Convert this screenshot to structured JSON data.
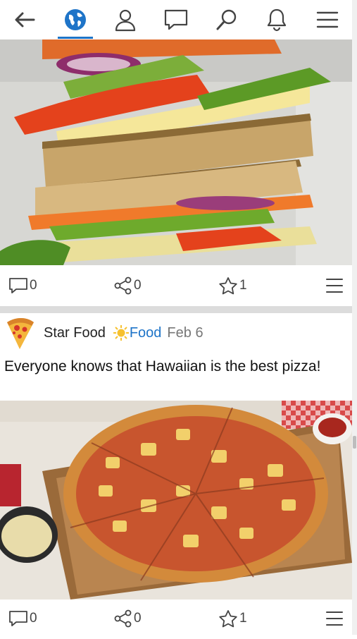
{
  "nav": {
    "items": [
      {
        "icon": "back-arrow-icon"
      },
      {
        "icon": "globe-icon",
        "active": true
      },
      {
        "icon": "profile-icon"
      },
      {
        "icon": "chat-icon"
      },
      {
        "icon": "search-icon"
      },
      {
        "icon": "bell-icon"
      },
      {
        "icon": "menu-icon"
      }
    ],
    "accent": "#1e74c8"
  },
  "posts": [
    {
      "image": "sandwich-photo",
      "actions": {
        "comments": "0",
        "shares": "0",
        "favorites": "1"
      }
    },
    {
      "avatar": "pizza-slice-icon",
      "author": "Star Food",
      "category": "Food",
      "category_icon": "sun-icon",
      "date": "Feb 6",
      "text": "Everyone knows that Hawaiian is the best pizza!",
      "image": "pizza-photo",
      "actions": {
        "comments": "0",
        "shares": "0",
        "favorites": "1"
      }
    }
  ]
}
